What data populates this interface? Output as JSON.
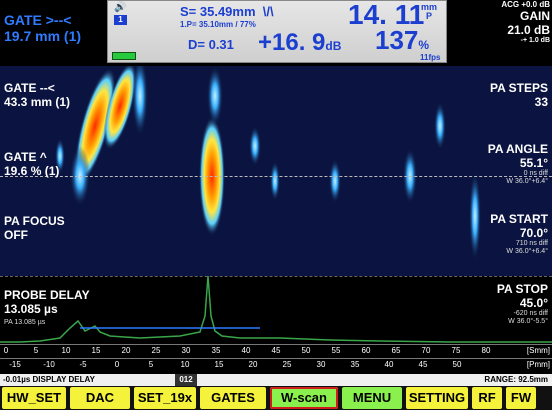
{
  "top": {
    "gate_line1": "GATE >--<",
    "gate_line2": "19.7 mm (1)",
    "channel_badge": "1",
    "wave_icon": "sound-wave-icon",
    "s_label": "S= 35.49mm",
    "s_symbol": "\\/\\",
    "p_label": "1.P= 35.10mm / 77%",
    "d_label": "D= 0.31",
    "amp_value": "+16. 9",
    "amp_unit": "dB",
    "depth_value": "14. 11",
    "depth_unit_top": "mm",
    "depth_unit_bot": "P",
    "pct_value": "137",
    "pct_unit": "%",
    "fps": "11fps",
    "battery_color": "#27c93f"
  },
  "gain": {
    "acg": "ACG +0.0 dB",
    "label": "GAIN",
    "value": "21.0 dB",
    "step": "-+ 1.0 dB"
  },
  "left_labels": {
    "gate_echo": "GATE --<",
    "gate_echo_val": "43.3 mm (1)",
    "gate_caret": "GATE ^",
    "gate_caret_val": "19.6 % (1)",
    "pa_focus": "PA FOCUS",
    "pa_focus_val": "OFF",
    "probe_delay": "PROBE DELAY",
    "probe_delay_val": "13.085 µs",
    "probe_delay_sub": "PA 13.085 µs"
  },
  "right_labels": {
    "pa_steps": "PA STEPS",
    "pa_steps_val": "33",
    "pa_angle": "PA ANGLE",
    "pa_angle_val": "55.1°",
    "pa_angle_sub1": "0 ns diff",
    "pa_angle_sub2": "W 36.0°+6.4°",
    "pa_start": "PA START",
    "pa_start_val": "70.0°",
    "pa_start_sub1": "710 ns diff",
    "pa_start_sub2": "W 36.0°+6.4°",
    "pa_stop": "PA STOP",
    "pa_stop_val": "45.0°",
    "pa_stop_sub1": "-620 ns diff",
    "pa_stop_sub2": "W 36.0°-5.5°"
  },
  "axis": {
    "top_unit": "[Smm]",
    "bottom_unit": "[Pmm]",
    "top_ticks": [
      "0",
      "5",
      "10",
      "15",
      "20",
      "25",
      "30",
      "35",
      "40",
      "45",
      "50",
      "55",
      "60",
      "65",
      "70",
      "75",
      "80"
    ],
    "bottom_ticks": [
      "-15",
      "-10",
      "-5",
      "0",
      "5",
      "10",
      "15",
      "20",
      "25",
      "30",
      "35",
      "40",
      "45",
      "50"
    ]
  },
  "status": {
    "left": "-0.01µs  DISPLAY DELAY",
    "mid": "012",
    "right": "RANGE: 92.5mm"
  },
  "buttons": [
    {
      "label": "HW_SET"
    },
    {
      "label": "DAC"
    },
    {
      "label": "SET_19x"
    },
    {
      "label": "GATES"
    },
    {
      "label": "W-scan"
    },
    {
      "label": "MENU"
    },
    {
      "label": "SETTING"
    },
    {
      "label": "RF"
    },
    {
      "label": "FW"
    }
  ],
  "colors": {
    "accent_blue": "#1c3fd0",
    "button_yellow": "#f4f23a",
    "button_green": "#8af04d",
    "selected_outline": "#d21b1b",
    "ascan_green": "#3aa64a"
  }
}
